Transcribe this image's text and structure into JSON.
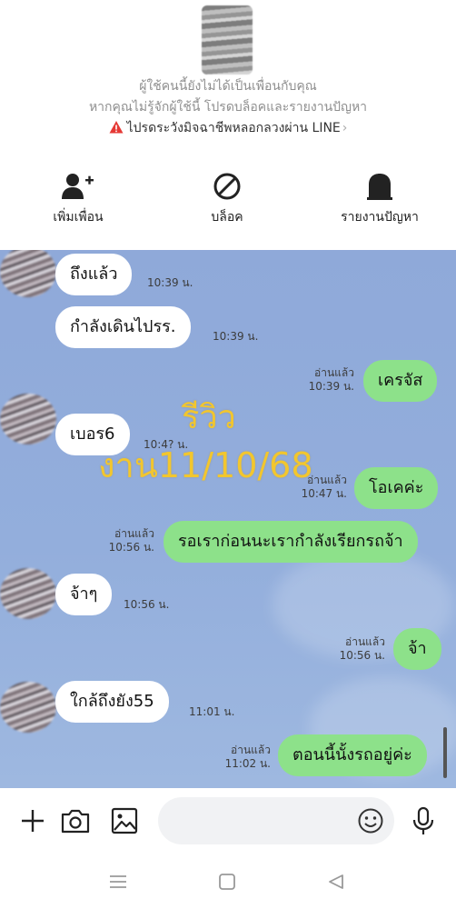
{
  "header": {
    "notice_not_friend": "ผู้ใช้คนนี้ยังไม่ได้เป็นเพื่อนกับคุณ",
    "notice_block_report": "หากคุณไม่รู้จักผู้ใช้นี้ โปรดบล็อคและรายงานปัญหา",
    "scam_warning": "ไปรดระวังมิจฉาชีพหลอกลวงผ่าน LINE",
    "scam_warning_chevron": "›",
    "actions": [
      {
        "icon": "add-friend-icon",
        "label": "เพิ่มเพื่อน"
      },
      {
        "icon": "block-icon",
        "label": "บล็อค"
      },
      {
        "icon": "report-icon",
        "label": "รายงานปัญหา"
      }
    ]
  },
  "chat": {
    "watermark_line1": "รีวิว",
    "watermark_line2": "งาน11/10/68",
    "messages": [
      {
        "direction": "in",
        "text": "ถึงแล้ว",
        "time": "10:39 น."
      },
      {
        "direction": "in",
        "text": "กำลังเดินไปรร.",
        "time": "10:39 น."
      },
      {
        "direction": "out",
        "text": "เครจัส",
        "read": "อ่านแล้ว",
        "time": "10:39 น."
      },
      {
        "direction": "in",
        "text": "เบอร6",
        "time": "10:4? น."
      },
      {
        "direction": "out",
        "text": "โอเคค่ะ",
        "read": "อ่านแล้ว",
        "time": "10:47 น."
      },
      {
        "direction": "out",
        "text": "รอเราก่อนนะเรากำลังเรียกรถจ้า",
        "read": "อ่านแล้ว",
        "time": "10:56 น."
      },
      {
        "direction": "in",
        "text": "จ้าๆ",
        "time": "10:56 น."
      },
      {
        "direction": "out",
        "text": "จ้า",
        "read": "อ่านแล้ว",
        "time": "10:56 น."
      },
      {
        "direction": "in",
        "text": "ใกล้ถึงยัง55",
        "time": "11:01 น."
      },
      {
        "direction": "out",
        "text": "ตอนนี้นั้งรถอยู่ค่ะ",
        "read": "อ่านแล้ว",
        "time": "11:02 น."
      }
    ]
  },
  "input_bar": {
    "message_value": "",
    "icons": [
      "plus-icon",
      "camera-icon",
      "image-icon",
      "emoji-icon",
      "microphone-icon"
    ]
  },
  "system_nav": {
    "icons": [
      "recents-icon",
      "home-icon",
      "back-icon"
    ]
  },
  "colors": {
    "chat_background": "#93aedc",
    "outgoing_bubble": "#8de18a",
    "incoming_bubble": "#ffffff",
    "watermark": "#f2c62e",
    "warning_red": "#e53935"
  }
}
